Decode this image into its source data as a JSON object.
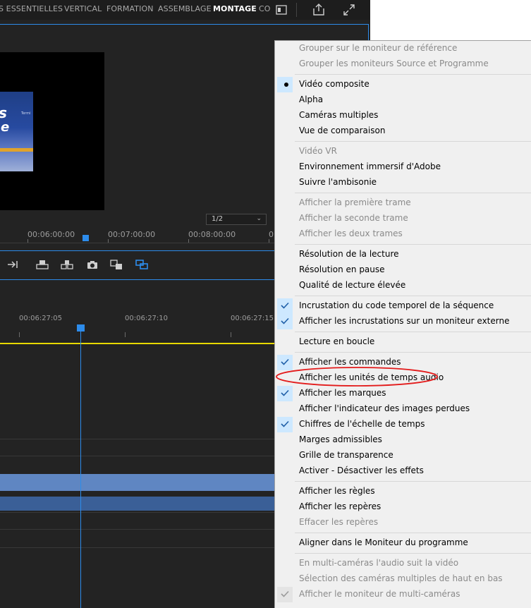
{
  "workspace_tabs": [
    {
      "label": "S ESSENTIELLES",
      "active": false
    },
    {
      "label": "VERTICAL",
      "active": false
    },
    {
      "label": "FORMATION",
      "active": false
    },
    {
      "label": "ASSEMBLAGE",
      "active": false
    },
    {
      "label": "MONTAGE",
      "active": true
    },
    {
      "label": "CO",
      "active": false
    }
  ],
  "toolbar_icons": [
    "workspace-panel-icon",
    "share-icon",
    "maximize-icon"
  ],
  "program_monitor": {
    "resolution_value": "1/2",
    "ruler_timecodes": [
      "00:06:00:00",
      "00:07:00:00",
      "00:08:00:00",
      "0"
    ],
    "thumbnail_text": [
      "s",
      "e",
      "Termi"
    ]
  },
  "control_icons": [
    "insert-icon",
    "lift-icon",
    "extract-icon",
    "export-frame-icon",
    "comparison-view-icon",
    "trim-icon"
  ],
  "timeline": {
    "ruler_timecodes": [
      "00:06:27:05",
      "00:06:27:10",
      "00:06:27:15"
    ]
  },
  "context_menu": {
    "groups": [
      [
        {
          "label": "Grouper sur le moniteur de référence",
          "state": "none",
          "enabled": false
        },
        {
          "label": "Grouper les moniteurs Source et Programme",
          "state": "none",
          "enabled": false
        }
      ],
      [
        {
          "label": "Vidéo composite",
          "state": "bullet",
          "enabled": true
        },
        {
          "label": "Alpha",
          "state": "none",
          "enabled": true
        },
        {
          "label": "Caméras multiples",
          "state": "none",
          "enabled": true
        },
        {
          "label": "Vue de comparaison",
          "state": "none",
          "enabled": true
        }
      ],
      [
        {
          "label": "Vidéo VR",
          "state": "none",
          "enabled": false
        },
        {
          "label": "Environnement immersif d'Adobe",
          "state": "none",
          "enabled": true
        },
        {
          "label": "Suivre l'ambisonie",
          "state": "none",
          "enabled": true
        }
      ],
      [
        {
          "label": "Afficher la première trame",
          "state": "none",
          "enabled": false
        },
        {
          "label": "Afficher la seconde trame",
          "state": "none",
          "enabled": false
        },
        {
          "label": "Afficher les deux trames",
          "state": "none",
          "enabled": false
        }
      ],
      [
        {
          "label": "Résolution de la lecture",
          "state": "none",
          "enabled": true
        },
        {
          "label": "Résolution en pause",
          "state": "none",
          "enabled": true
        },
        {
          "label": "Qualité de lecture élevée",
          "state": "none",
          "enabled": true
        }
      ],
      [
        {
          "label": "Incrustation du code temporel de la séquence",
          "state": "check",
          "enabled": true
        },
        {
          "label": "Afficher les incrustations sur un moniteur externe",
          "state": "check",
          "enabled": true
        }
      ],
      [
        {
          "label": "Lecture en boucle",
          "state": "none",
          "enabled": true
        }
      ],
      [
        {
          "label": "Afficher les commandes",
          "state": "check",
          "enabled": true
        },
        {
          "label": "Afficher les unités de temps audio",
          "state": "none",
          "enabled": true
        },
        {
          "label": "Afficher les marques",
          "state": "check",
          "enabled": true
        },
        {
          "label": "Afficher l'indicateur des images perdues",
          "state": "none",
          "enabled": true
        },
        {
          "label": "Chiffres de l'échelle de temps",
          "state": "check",
          "enabled": true
        },
        {
          "label": "Marges admissibles",
          "state": "none",
          "enabled": true
        },
        {
          "label": "Grille de transparence",
          "state": "none",
          "enabled": true
        },
        {
          "label": "Activer - Désactiver les effets",
          "state": "none",
          "enabled": true
        }
      ],
      [
        {
          "label": "Afficher les règles",
          "state": "none",
          "enabled": true
        },
        {
          "label": "Afficher les repères",
          "state": "none",
          "enabled": true
        },
        {
          "label": "Effacer les repères",
          "state": "none",
          "enabled": false
        }
      ],
      [
        {
          "label": "Aligner dans le Moniteur du programme",
          "state": "none",
          "enabled": true
        }
      ],
      [
        {
          "label": "En multi-caméras l'audio suit la vidéo",
          "state": "none",
          "enabled": false
        },
        {
          "label": "Sélection des caméras multiples de haut en bas",
          "state": "none",
          "enabled": false
        },
        {
          "label": "Afficher le moniteur de multi-caméras",
          "state": "check",
          "enabled": false
        }
      ]
    ]
  },
  "annotation": {
    "highlighted_item": "Afficher les unités de temps audio",
    "color": "#e31b1b"
  },
  "colors": {
    "accent": "#2d8ceb",
    "check_bg": "#cde8ff",
    "menu_bg": "#f0f0f0",
    "app_bg": "#232323",
    "timeline_marker": "#e8d900",
    "audio_clip": "#5f86c2"
  }
}
